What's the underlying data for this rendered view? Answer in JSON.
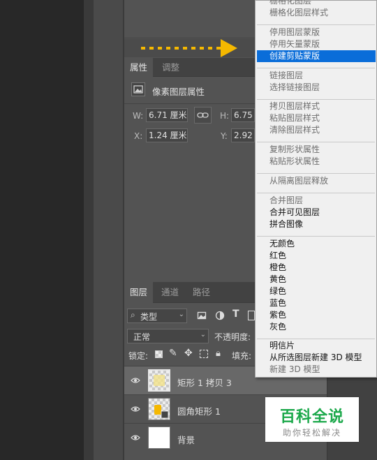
{
  "properties_panel": {
    "tabs": [
      "属性",
      "调整"
    ],
    "header": "像素图层属性",
    "w_label": "W:",
    "w_value": "6.71 厘米",
    "h_label": "H:",
    "h_value": "6.75 厘",
    "x_label": "X:",
    "x_value": "1.24 厘米",
    "y_label": "Y:",
    "y_value": "2.92 厘"
  },
  "layers_panel": {
    "tabs": [
      "图层",
      "通道",
      "路径"
    ],
    "filter_kind": "类型",
    "blend_mode": "正常",
    "opacity_label": "不透明度:",
    "lock_label": "锁定:",
    "fill_label": "填充:",
    "layers": [
      {
        "name": "矩形 1 拷贝 3",
        "selected": true
      },
      {
        "name": "圆角矩形 1",
        "selected": false
      },
      {
        "name": "背景",
        "selected": false
      }
    ]
  },
  "context_menu": {
    "items": [
      {
        "label": "栅格化图层",
        "disabled": true
      },
      {
        "label": "栅格化图层样式",
        "disabled": true
      },
      {
        "sep": true
      },
      {
        "label": "停用图层蒙版",
        "disabled": true
      },
      {
        "label": "停用矢量蒙版",
        "disabled": true
      },
      {
        "label": "创建剪贴蒙版",
        "disabled": false,
        "highlighted": true
      },
      {
        "sep": true
      },
      {
        "label": "链接图层",
        "disabled": true
      },
      {
        "label": "选择链接图层",
        "disabled": true
      },
      {
        "sep": true
      },
      {
        "label": "拷贝图层样式",
        "disabled": true
      },
      {
        "label": "粘贴图层样式",
        "disabled": true
      },
      {
        "label": "清除图层样式",
        "disabled": true
      },
      {
        "sep": true
      },
      {
        "label": "复制形状属性",
        "disabled": true
      },
      {
        "label": "粘贴形状属性",
        "disabled": true
      },
      {
        "sep": true
      },
      {
        "label": "从隔离图层释放",
        "disabled": true
      },
      {
        "sep": true
      },
      {
        "label": "合并图层",
        "disabled": true
      },
      {
        "label": "合并可见图层",
        "disabled": false
      },
      {
        "label": "拼合图像",
        "disabled": false
      },
      {
        "sep": true
      },
      {
        "label": "无颜色",
        "disabled": false
      },
      {
        "label": "红色",
        "disabled": false
      },
      {
        "label": "橙色",
        "disabled": false
      },
      {
        "label": "黄色",
        "disabled": false
      },
      {
        "label": "绿色",
        "disabled": false
      },
      {
        "label": "蓝色",
        "disabled": false
      },
      {
        "label": "紫色",
        "disabled": false
      },
      {
        "label": "灰色",
        "disabled": false
      },
      {
        "sep": true
      },
      {
        "label": "明信片",
        "disabled": false
      },
      {
        "label": "从所选图层新建 3D 模型",
        "disabled": false
      },
      {
        "label": "新建 3D 模型",
        "disabled": true
      }
    ]
  },
  "watermark": {
    "title": "百科全说",
    "subtitle": "助你轻松解决"
  },
  "colors": {
    "highlight": "#0a6dd9",
    "arrow": "#f5b800",
    "watermark_green": "#1ba84a"
  }
}
